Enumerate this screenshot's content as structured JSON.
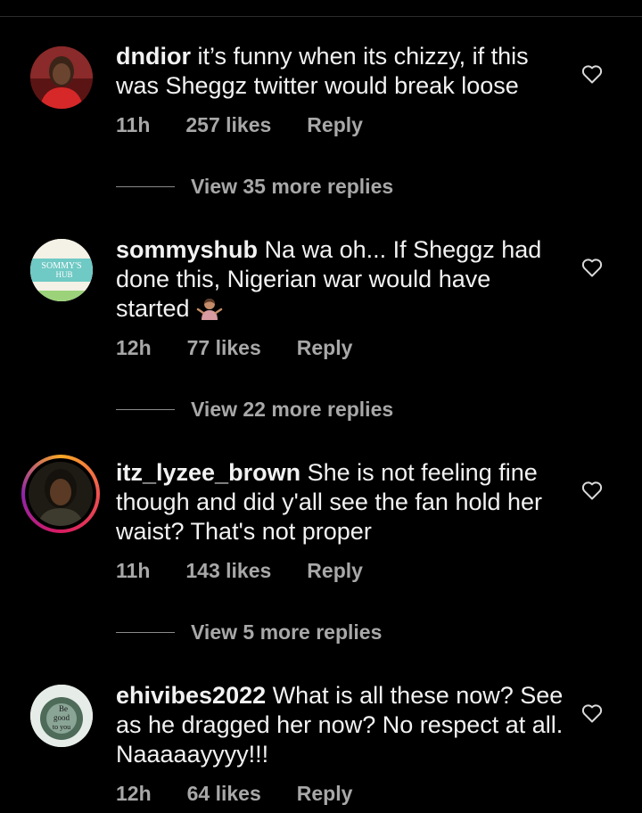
{
  "comments": [
    {
      "username": "dndior",
      "text": "it’s funny when its chizzy, if this was Sheggz twitter would break loose",
      "time": "11h",
      "likes": "257 likes",
      "reply": "Reply",
      "view_replies": "View 35 more replies"
    },
    {
      "username": "sommyshub",
      "text": "Na wa oh... If Sheggz had done this, Nigerian war would have started",
      "avatar_text_1": "SOMMY'S",
      "avatar_text_2": "HUB",
      "time": "12h",
      "likes": "77 likes",
      "reply": "Reply",
      "view_replies": "View 22 more replies"
    },
    {
      "username": "itz_lyzee_brown",
      "text": "She is not feeling fine though and did y'all see the fan hold her waist? That's not proper",
      "time": "11h",
      "likes": "143 likes",
      "reply": "Reply",
      "view_replies": "View 5 more replies"
    },
    {
      "username": "ehivibes2022",
      "text": "What is all these now? See as he dragged her now? No respect at all. Naaaaayyyy!!!",
      "avatar_text_1": "Be",
      "avatar_text_2": "good",
      "avatar_text_3": "to you",
      "time": "12h",
      "likes": "64 likes",
      "reply": "Reply"
    }
  ],
  "icons": {
    "heart": "heart-outline-icon",
    "emoji": "person-shrugging-emoji"
  },
  "colors": {
    "background": "#000000",
    "text": "#f2f2f2",
    "secondary": "#a8a8a8"
  }
}
